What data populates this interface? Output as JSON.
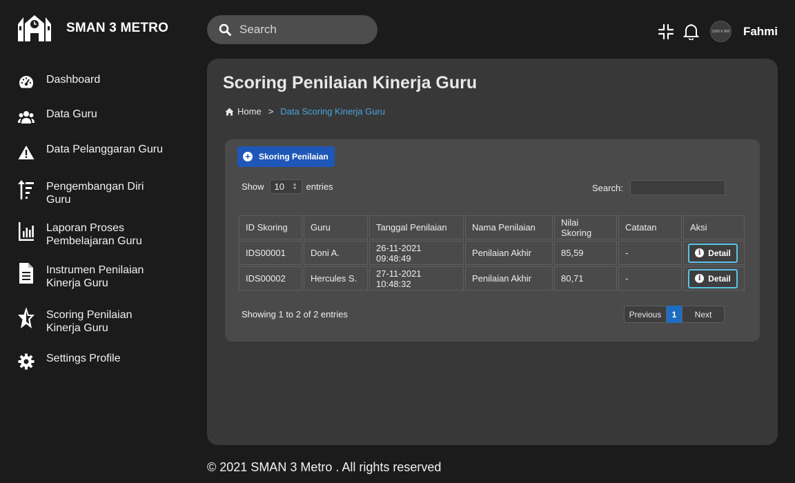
{
  "brand": {
    "name": "SMAN 3 METRO"
  },
  "sidebar": {
    "items": [
      {
        "label": "Dashboard",
        "icon": "dashboard-icon"
      },
      {
        "label": "Data Guru",
        "icon": "users-icon"
      },
      {
        "label": "Data Pelanggaran Guru",
        "icon": "warning-icon"
      },
      {
        "label": "Pengembangan Diri Guru",
        "icon": "sort-up-icon"
      },
      {
        "label": "Laporan Proses Pembelajaran Guru",
        "icon": "chart-icon"
      },
      {
        "label": "Instrumen Penilaian Kinerja Guru",
        "icon": "document-icon"
      },
      {
        "label": "Scoring Penilaian Kinerja Guru",
        "icon": "star-icon"
      },
      {
        "label": "Settings Profile",
        "icon": "gear-icon"
      }
    ]
  },
  "search": {
    "placeholder": "Search"
  },
  "user": {
    "name": "Fahmi",
    "avatar_text": "1200 X 900"
  },
  "page": {
    "title": "Scoring Penilaian Kinerja Guru",
    "breadcrumb": {
      "home": "Home",
      "separator": ">",
      "current": "Data Scoring Kinerja Guru"
    }
  },
  "table_controls": {
    "add_button": "Skoring Penilaian",
    "show_label": "Show",
    "entries_value": "10",
    "entries_label": "entries",
    "search_label": "Search:"
  },
  "table": {
    "headers": [
      "ID Skoring",
      "Guru",
      "Tanggal Penilaian",
      "Nama Penilaian",
      "Nilai Skoring",
      "Catatan",
      "Aksi"
    ],
    "rows": [
      {
        "id": "IDS00001",
        "guru": "Doni A.",
        "tanggal": "26-11-2021 09:48:49",
        "nama": "Penilaian Akhir",
        "nilai": "85,59",
        "catatan": "-",
        "aksi": "Detail"
      },
      {
        "id": "IDS00002",
        "guru": "Hercules S.",
        "tanggal": "27-11-2021 10:48:32",
        "nama": "Penilaian Akhir",
        "nilai": "80,71",
        "catatan": "-",
        "aksi": "Detail"
      }
    ]
  },
  "pagination": {
    "info": "Showing 1 to 2 of 2 entries",
    "previous": "Previous",
    "current_page": "1",
    "next": "Next"
  },
  "footer": {
    "text": "© 2021 SMAN 3 Metro . All rights reserved"
  },
  "colors": {
    "accent": "#1f57b8",
    "link": "#4aa3df",
    "detail_border": "#5bc3e6",
    "panel": "#383838",
    "background": "#1b1b1b"
  }
}
